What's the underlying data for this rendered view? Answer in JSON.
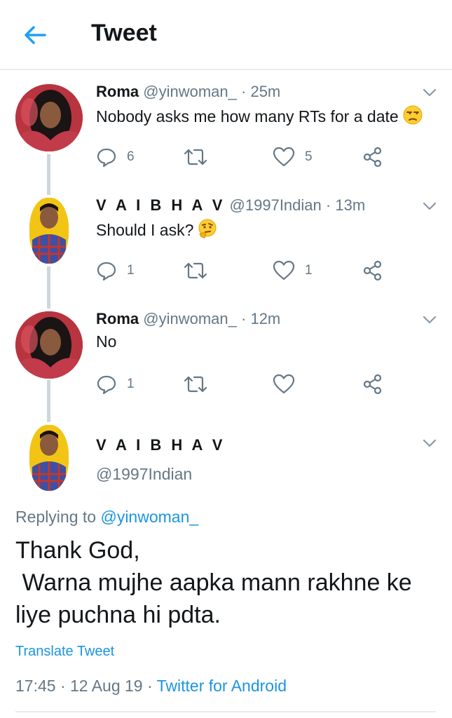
{
  "header": {
    "title": "Tweet",
    "back_icon": "arrow-left-icon",
    "accent": "#1da1f2"
  },
  "tweets": [
    {
      "name": "Roma",
      "handle": "@yinwoman_",
      "sep": "·",
      "time": "25m",
      "text": "Nobody asks me how many RTs for a date",
      "emoji": "unamused-face",
      "reply_count": "6",
      "like_count": "5"
    },
    {
      "name": "V A I B H A V",
      "handle": "@1997Indian",
      "sep": "·",
      "time": "13m",
      "text": "Should I ask?",
      "emoji": "thinking-face",
      "reply_count": "1",
      "like_count": "1"
    },
    {
      "name": "Roma",
      "handle": "@yinwoman_",
      "sep": "·",
      "time": "12m",
      "text": "No",
      "reply_count": "1",
      "like_count": ""
    }
  ],
  "focused": {
    "name": "V A I B H A V",
    "handle": "@1997Indian",
    "replying_prefix": "Replying to ",
    "replying_handle": "@yinwoman_",
    "text": "Thank God,\n Warna mujhe aapka mann rakhne ke\nliye puchna hi pdta.",
    "translate_label": "Translate Tweet",
    "timestamp": "17:45 · 12 Aug 19 · ",
    "source": "Twitter for Android"
  },
  "colors": {
    "text": "#14171a",
    "secondary": "#657786",
    "link": "#1b95e0",
    "divider": "#e6ecf0"
  }
}
